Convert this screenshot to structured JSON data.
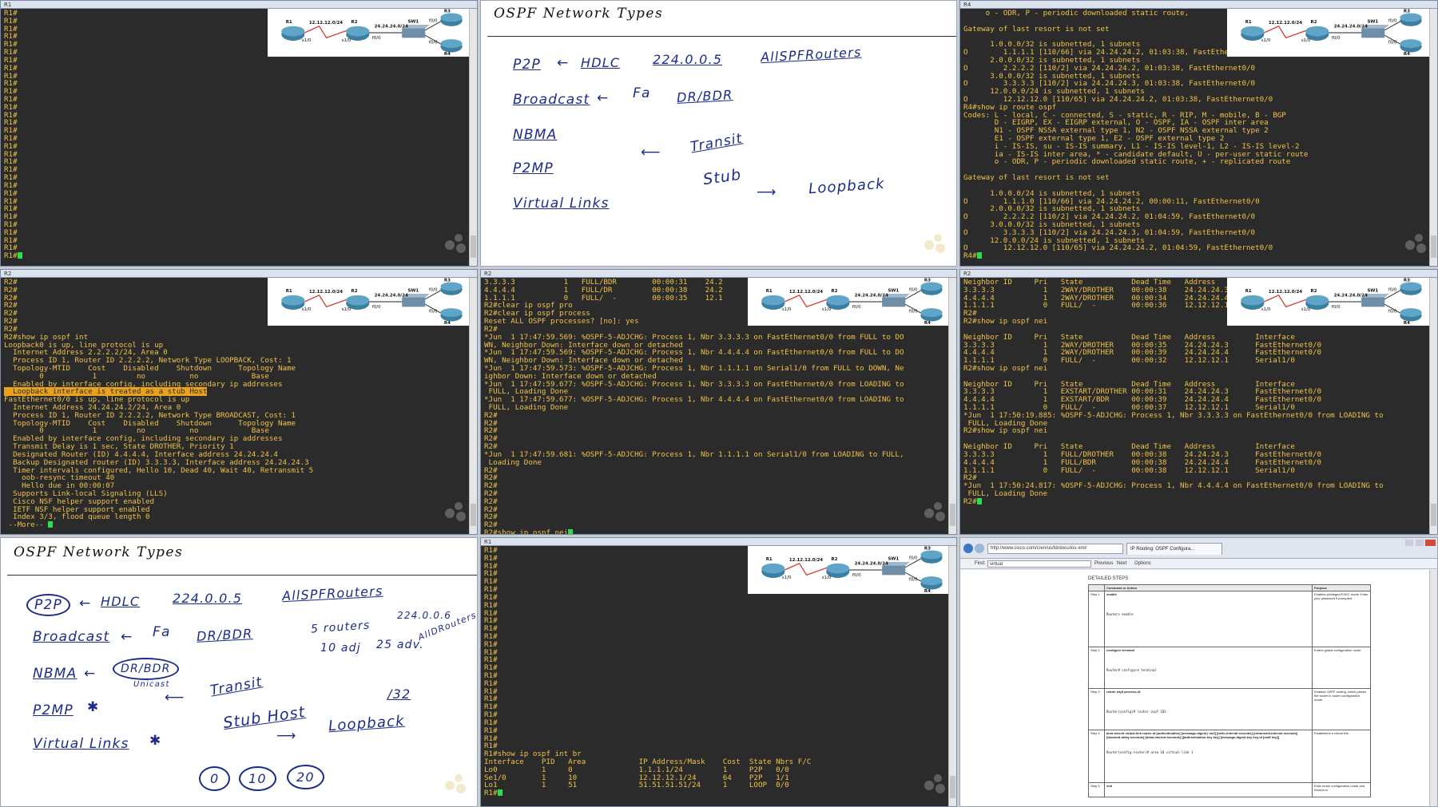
{
  "topology": {
    "r1": "R1",
    "r2": "R2",
    "r3": "R3",
    "r4": "R4",
    "sw1": "SW1",
    "net1": "12.12.12.0/24",
    "net2": "24.24.24.0/24",
    "if_r1": "s1/0",
    "if_r2s": "s1/0",
    "if_r2f": "f0/0",
    "if_r3": "f0/0",
    "if_r4": "f0/0"
  },
  "tiles": {
    "t1": {
      "title": "R1",
      "lines": [
        "R1#",
        "R1#",
        "R1#",
        "R1#",
        "R1#",
        "R1#",
        "R1#",
        "R1#",
        "R1#",
        "R1#",
        "R1#",
        "R1#",
        "R1#",
        "R1#",
        "R1#",
        "R1#",
        "R1#",
        "R1#",
        "R1#",
        "R1#",
        "R1#",
        "R1#",
        "R1#",
        "R1#",
        "R1#",
        "R1#",
        "R1#",
        "R1#",
        "R1#",
        "R1#",
        "R1#",
        "R1#"
      ]
    },
    "t3": {
      "title": "R4",
      "lines": [
        "     o - ODR, P - periodic downloaded static route,",
        "",
        "Gateway of last resort is not set",
        "",
        "      1.0.0.0/32 is subnetted, 1 subnets",
        "O        1.1.1.1 [110/66] via 24.24.24.2, 01:03:38, FastEthernet0/0",
        "      2.0.0.0/32 is subnetted, 1 subnets",
        "O        2.2.2.2 [110/2] via 24.24.24.2, 01:03:38, FastEthernet0/0",
        "      3.0.0.0/32 is subnetted, 1 subnets",
        "O        3.3.3.3 [110/2] via 24.24.24.3, 01:03:38, FastEthernet0/0",
        "      12.0.0.0/24 is subnetted, 1 subnets",
        "O        12.12.12.0 [110/65] via 24.24.24.2, 01:03:38, FastEthernet0/0",
        "R4#show ip route ospf",
        "Codes: L - local, C - connected, S - static, R - RIP, M - mobile, B - BGP",
        "       D - EIGRP, EX - EIGRP external, O - OSPF, IA - OSPF inter area",
        "       N1 - OSPF NSSA external type 1, N2 - OSPF NSSA external type 2",
        "       E1 - OSPF external type 1, E2 - OSPF external type 2",
        "       i - IS-IS, su - IS-IS summary, L1 - IS-IS level-1, L2 - IS-IS level-2",
        "       ia - IS-IS inter area, * - candidate default, U - per-user static route",
        "       o - ODR, P - periodic downloaded static route, + - replicated route",
        "",
        "Gateway of last resort is not set",
        "",
        "      1.0.0.0/24 is subnetted, 1 subnets",
        "O        1.1.1.0 [110/66] via 24.24.24.2, 00:00:11, FastEthernet0/0",
        "      2.0.0.0/32 is subnetted, 1 subnets",
        "O        2.2.2.2 [110/2] via 24.24.24.2, 01:04:59, FastEthernet0/0",
        "      3.0.0.0/32 is subnetted, 1 subnets",
        "O        3.3.3.3 [110/2] via 24.24.24.3, 01:04:59, FastEthernet0/0",
        "      12.0.0.0/24 is subnetted, 1 subnets",
        "O        12.12.12.0 [110/65] via 24.24.24.2, 01:04:59, FastEthernet0/0",
        "R4#"
      ]
    },
    "t4": {
      "title": "R2",
      "lines": [
        "R2#",
        "R2#",
        "R2#",
        "R2#",
        "R2#",
        "R2#",
        "R2#",
        "R2#show ip ospf int",
        "Loopback0 is up, line protocol is up",
        "  Internet Address 2.2.2.2/24, Area 0",
        "  Process ID 1, Router ID 2.2.2.2, Network Type LOOPBACK, Cost: 1",
        "  Topology-MTID    Cost    Disabled    Shutdown      Topology Name",
        "        0           1         no          no            Base",
        "  Enabled by interface config, including secondary ip addresses",
        "  Loopback interface is treated as a stub Host",
        "FastEthernet0/0 is up, line protocol is up",
        "  Internet Address 24.24.24.2/24, Area 0",
        "  Process ID 1, Router ID 2.2.2.2, Network Type BROADCAST, Cost: 1",
        "  Topology-MTID    Cost    Disabled    Shutdown      Topology Name",
        "        0           1         no          no            Base",
        "  Enabled by interface config, including secondary ip addresses",
        "  Transmit Delay is 1 sec, State DROTHER, Priority 1",
        "  Designated Router (ID) 4.4.4.4, Interface address 24.24.24.4",
        "  Backup Designated router (ID) 3.3.3.3, Interface address 24.24.24.3",
        "  Timer intervals configured, Hello 10, Dead 40, Wait 40, Retransmit 5",
        "    oob-resync timeout 40",
        "    Hello due in 00:00:07",
        "  Supports Link-local Signaling (LLS)",
        "  Cisco NSF helper support enabled",
        "  IETF NSF helper support enabled",
        "  Index 3/3, flood queue length 0",
        " --More-- "
      ]
    },
    "t5": {
      "title": "R2",
      "lines": [
        "3.3.3.3           1   FULL/BDR        00:00:31    24.2",
        "4.4.4.4           1   FULL/DR         00:00:38    24.2",
        "1.1.1.1           0   FULL/  -        00:00:35    12.1",
        "R2#clear ip ospf pro",
        "R2#clear ip ospf process",
        "Reset ALL OSPF processes? [no]: yes",
        "R2#",
        "*Jun  1 17:47:59.569: %OSPF-5-ADJCHG: Process 1, Nbr 3.3.3.3 on FastEthernet0/0 from FULL to DO",
        "WN, Neighbor Down: Interface down or detached",
        "*Jun  1 17:47:59.569: %OSPF-5-ADJCHG: Process 1, Nbr 4.4.4.4 on FastEthernet0/0 from FULL to DO",
        "WN, Neighbor Down: Interface down or detached",
        "*Jun  1 17:47:59.573: %OSPF-5-ADJCHG: Process 1, Nbr 1.1.1.1 on Serial1/0 from FULL to DOWN, Ne",
        "ighbor Down: Interface down or detached",
        "*Jun  1 17:47:59.677: %OSPF-5-ADJCHG: Process 1, Nbr 3.3.3.3 on FastEthernet0/0 from LOADING to",
        " FULL, Loading Done",
        "*Jun  1 17:47:59.677: %OSPF-5-ADJCHG: Process 1, Nbr 4.4.4.4 on FastEthernet0/0 from LOADING to",
        " FULL, Loading Done",
        "R2#",
        "R2#",
        "R2#",
        "R2#",
        "R2#",
        "*Jun  1 17:47:59.681: %OSPF-5-ADJCHG: Process 1, Nbr 1.1.1.1 on Serial1/0 from LOADING to FULL,",
        " Loading Done",
        "R2#",
        "R2#",
        "R2#",
        "R2#",
        "R2#",
        "R2#",
        "R2#",
        "R2#",
        "R2#show ip ospf nei"
      ]
    },
    "t6": {
      "title": "R2",
      "lines": [
        "Neighbor ID     Pri   State           Dead Time   Address         Interface",
        "3.3.3.3           1   2WAY/DROTHER    00:00:38    24.24.24.3      FastEthernet0/0",
        "4.4.4.4           1   2WAY/DROTHER    00:00:34    24.24.24.4      FastEthernet0/0",
        "1.1.1.1           0   FULL/  -        00:00:36    12.12.12.1      Serial1/0",
        "R2#",
        "R2#show ip ospf nei",
        "",
        "Neighbor ID     Pri   State           Dead Time   Address         Interface",
        "3.3.3.3           1   2WAY/DROTHER    00:00:35    24.24.24.3      FastEthernet0/0",
        "4.4.4.4           1   2WAY/DROTHER    00:00:39    24.24.24.4      FastEthernet0/0",
        "1.1.1.1           0   FULL/  -        00:00:32    12.12.12.1      Serial1/0",
        "R2#show ip ospf nei",
        "",
        "Neighbor ID     Pri   State           Dead Time   Address         Interface",
        "3.3.3.3           1   EXSTART/DROTHER 00:00:31    24.24.24.3      FastEthernet0/0",
        "4.4.4.4           1   EXSTART/BDR     00:00:39    24.24.24.4      FastEthernet0/0",
        "1.1.1.1           0   FULL/  -        00:00:37    12.12.12.1      Serial1/0",
        "*Jun  1 17:50:19.885: %OSPF-5-ADJCHG: Process 1, Nbr 3.3.3.3 on FastEthernet0/0 from LOADING to",
        " FULL, Loading Done",
        "R2#show ip ospf nei",
        "",
        "Neighbor ID     Pri   State           Dead Time   Address         Interface",
        "3.3.3.3           1   FULL/DROTHER    00:00:38    24.24.24.3      FastEthernet0/0",
        "4.4.4.4           1   FULL/BDR        00:00:38    24.24.24.4      FastEthernet0/0",
        "1.1.1.1           0   FULL/  -        00:00:38    12.12.12.1      Serial1/0",
        "R2#",
        "*Jun  1 17:50:24.817: %OSPF-5-ADJCHG: Process 1, Nbr 4.4.4.4 on FastEthernet0/0 from LOADING to",
        " FULL, Loading Done",
        "R2#"
      ]
    },
    "t8": {
      "title": "R1",
      "lines": [
        "R1#",
        "R1#",
        "R1#",
        "R1#",
        "R1#",
        "R1#",
        "R1#",
        "R1#",
        "R1#",
        "R1#",
        "R1#",
        "R1#",
        "R1#",
        "R1#",
        "R1#",
        "R1#",
        "R1#",
        "R1#",
        "R1#",
        "R1#",
        "R1#",
        "R1#",
        "R1#",
        "R1#",
        "R1#",
        "R1#",
        "R1#show ip ospf int br",
        "Interface    PID   Area            IP Address/Mask    Cost  State Nbrs F/C",
        "Lo0          1     0               1.1.1.1/24         1     P2P   0/0",
        "Se1/0        1     10              12.12.12.1/24      64    P2P   1/1",
        "Lo1          1     51              51.51.51.51/24     1     LOOP  0/0",
        "R1#"
      ]
    }
  },
  "whiteboard_top": {
    "title": "OSPF Network Types",
    "p2p": "P2P",
    "hdlc": "HDLC",
    "mcast": "224.0.0.5",
    "allspf": "AllSPFRouters",
    "broadcast": "Broadcast",
    "fa": "Fa",
    "drbdr": "DR/BDR",
    "nbma": "NBMA",
    "transit": "Transit",
    "p2mp": "P2MP",
    "stub": "Stub",
    "loopback": "Loopback",
    "virtual": "Virtual Links"
  },
  "whiteboard_bottom": {
    "title": "OSPF Network Types",
    "p2p": "P2P",
    "hdlc": "HDLC",
    "mcast": "224.0.0.5",
    "allspf": "AllSPFRouters",
    "mcast6": "224.0.0.6",
    "alldr": "AllDRouters",
    "broadcast": "Broadcast",
    "fa": "Fa",
    "drbdr": "DR/BDR",
    "routers": "5 routers",
    "adj10": "10 adj",
    "adj25": "25 adv.",
    "nbma": "NBMA",
    "drbdr2": "DR/BDR",
    "unicast": "Unicast",
    "transit": "Transit",
    "p2mp": "P2MP",
    "star": "✱",
    "stubhost": "Stub Host",
    "slash32": "/32",
    "loopback": "Loopback",
    "virtual": "Virtual Links",
    "areas": [
      "0",
      "10",
      "20"
    ]
  },
  "browser": {
    "url": "http://www.cisco.com/c/en/us/td/docs/ios-xml/",
    "tab": "IP Routing: OSPF Configura...",
    "find_label": "Find:",
    "find_value": "virtual",
    "prev": "Previous",
    "next": "Next",
    "options": "Options",
    "heading": "DETAILED STEPS",
    "col1": "Command or Action",
    "col2": "Purpose",
    "steps": [
      {
        "step": "Step 1",
        "cmd": "enable",
        "example": "Router> enable",
        "purpose": "Enables privileged EXEC mode. Enter your password if prompted."
      },
      {
        "step": "Step 2",
        "cmd": "configure terminal",
        "example": "Router# configure terminal",
        "purpose": "Enters global configuration mode."
      },
      {
        "step": "Step 3",
        "cmd": "router ospf process-id",
        "example": "Router(config)# router ospf 103",
        "purpose": "Enables OSPF routing, which places the router in router configuration mode."
      },
      {
        "step": "Step 4",
        "cmd": "area area-id virtual-link router-id [authentication] [message-digest | null] [hello-interval seconds] [retransmit-interval seconds] [transmit-delay seconds] [dead-interval seconds] [[authentication-key key] [message-digest-key key-id [md5 key]]",
        "example": "Router(config-router)# area 10 virtual-link 1",
        "purpose": "Establishes a virtual link."
      },
      {
        "step": "Step 5",
        "cmd": "end",
        "example": "",
        "purpose": "Exits router configuration mode and returns to"
      }
    ]
  }
}
